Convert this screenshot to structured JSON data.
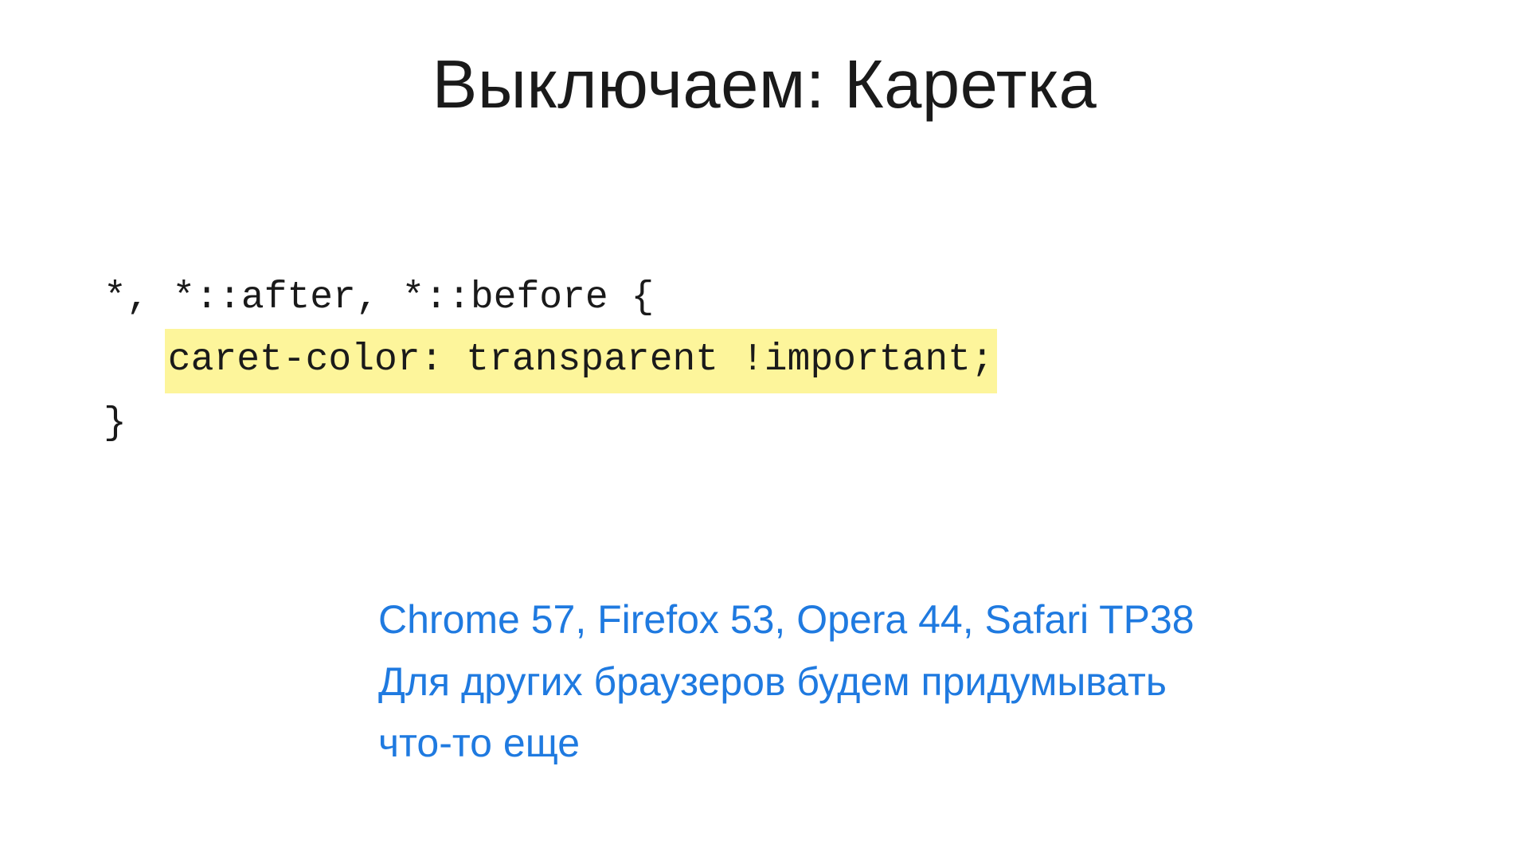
{
  "slide": {
    "title": "Выключаем: Каретка",
    "code": {
      "line1": "*, *::after, *::before {",
      "line2_highlight": "caret-color: transparent !important;",
      "line3": "}"
    },
    "notes": {
      "browsers": "Chrome 57, Firefox 53, Opera 44, Safari TP38",
      "other_line1": "Для других браузеров будем придумывать",
      "other_line2": "что-то еще"
    }
  }
}
